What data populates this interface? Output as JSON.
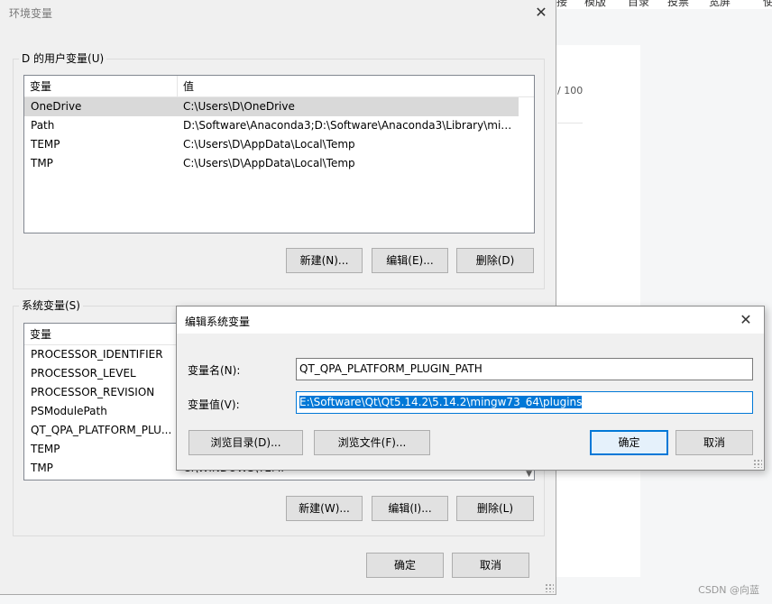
{
  "background": {
    "menu": [
      "接",
      "模版",
      "目录",
      "投票",
      "宽屏",
      "使"
    ],
    "word_counter": "/ 100",
    "watermark": "CSDN @向蓝"
  },
  "env_dialog": {
    "title": "环境变量",
    "user_group_label": "D 的用户变量(U)",
    "user_columns": [
      "变量",
      "值"
    ],
    "user_rows": [
      {
        "name": "OneDrive",
        "value": "C:\\Users\\D\\OneDrive"
      },
      {
        "name": "Path",
        "value": "D:\\Software\\Anaconda3;D:\\Software\\Anaconda3\\Library\\min..."
      },
      {
        "name": "TEMP",
        "value": "C:\\Users\\D\\AppData\\Local\\Temp"
      },
      {
        "name": "TMP",
        "value": "C:\\Users\\D\\AppData\\Local\\Temp"
      }
    ],
    "user_buttons": {
      "new": "新建(N)...",
      "edit": "编辑(E)...",
      "delete": "删除(D)"
    },
    "system_group_label": "系统变量(S)",
    "system_columns": [
      "变量"
    ],
    "system_rows": [
      {
        "name": "PROCESSOR_IDENTIFIER"
      },
      {
        "name": "PROCESSOR_LEVEL"
      },
      {
        "name": "PROCESSOR_REVISION"
      },
      {
        "name": "PSModulePath"
      },
      {
        "name": "QT_QPA_PLATFORM_PLU..."
      },
      {
        "name": "TEMP"
      },
      {
        "name": "TMP",
        "value": "C:\\WINDOWS\\TEMP"
      }
    ],
    "system_buttons": {
      "new": "新建(W)...",
      "edit": "编辑(I)...",
      "delete": "删除(L)"
    },
    "ok": "确定",
    "cancel": "取消"
  },
  "edit_dialog": {
    "title": "编辑系统变量",
    "name_label": "变量名(N):",
    "name_value": "QT_QPA_PLATFORM_PLUGIN_PATH",
    "value_label": "变量值(V):",
    "value_value": "E:\\Software\\Qt\\Qt5.14.2\\5.14.2\\mingw73_64\\plugins",
    "browse_dir": "浏览目录(D)...",
    "browse_file": "浏览文件(F)...",
    "ok": "确定",
    "cancel": "取消"
  }
}
